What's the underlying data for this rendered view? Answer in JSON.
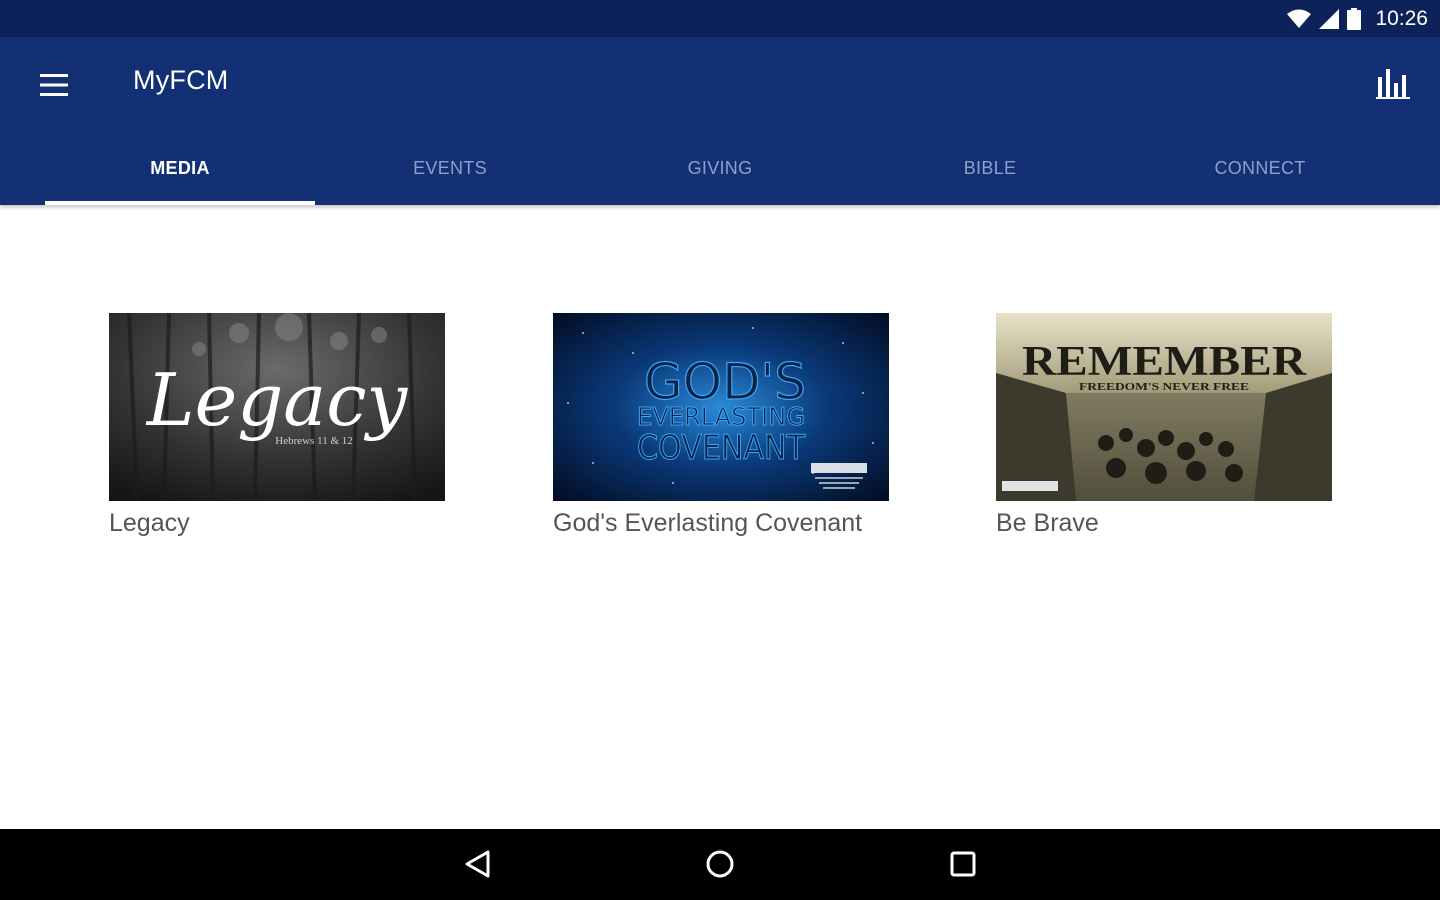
{
  "status_bar": {
    "time": "10:26",
    "icons": [
      "wifi-icon",
      "cell-signal-icon",
      "battery-icon"
    ]
  },
  "app_bar": {
    "title": "MyFCM",
    "menu_icon": "hamburger-menu-icon",
    "action_icon": "bar-chart-icon",
    "background": "#123073"
  },
  "tabs": [
    {
      "label": "MEDIA",
      "active": true
    },
    {
      "label": "EVENTS",
      "active": false
    },
    {
      "label": "GIVING",
      "active": false
    },
    {
      "label": "BIBLE",
      "active": false
    },
    {
      "label": "CONNECT",
      "active": false
    }
  ],
  "media": [
    {
      "title": "Legacy",
      "thumbnail": {
        "heading": "Legacy",
        "caption": "Hebrews 11 & 12"
      }
    },
    {
      "title": "God's Everlasting Covenant",
      "thumbnail": {
        "line1": "GOD'S",
        "line2": "EVERLASTING",
        "line3": "COVENANT"
      }
    },
    {
      "title": "Be Brave",
      "thumbnail": {
        "heading": "REMEMBER",
        "subheading": "FREEDOM'S NEVER FREE"
      }
    }
  ],
  "nav_bar": {
    "icons": [
      "back-icon",
      "home-icon",
      "recents-icon"
    ]
  }
}
